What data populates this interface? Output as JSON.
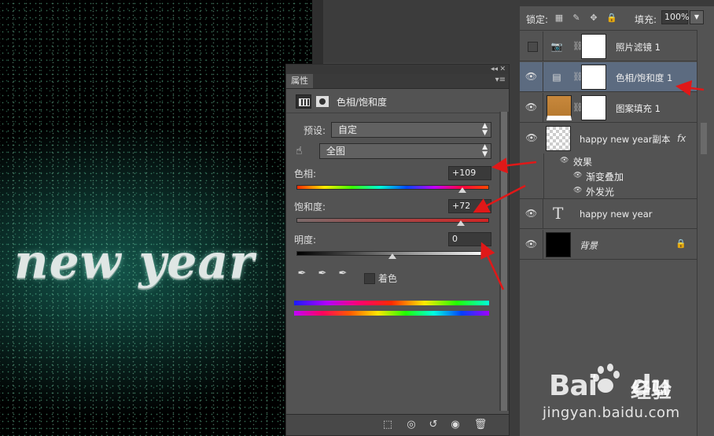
{
  "canvas": {
    "text": "new year"
  },
  "properties": {
    "tab_label": "属性",
    "title": "色相/饱和度",
    "preset_label": "预设:",
    "preset_value": "自定",
    "channel_value": "全图",
    "hue_label": "色相:",
    "hue_value": "+109",
    "hue_position": 0.87,
    "saturation_label": "饱和度:",
    "saturation_value": "+72",
    "saturation_position": 0.86,
    "lightness_label": "明度:",
    "lightness_value": "0",
    "lightness_position": 0.5,
    "colorize_label": "着色",
    "colorize_checked": false
  },
  "layers": {
    "lock_label": "锁定:",
    "fill_label": "填充:",
    "fill_value": "100%",
    "items": [
      {
        "name": "照片滤镜 1",
        "visible": false,
        "type": "adjustment"
      },
      {
        "name": "色相/饱和度 1",
        "visible": true,
        "selected": true,
        "type": "adjustment"
      },
      {
        "name": "图案填充 1",
        "visible": true,
        "type": "fill"
      },
      {
        "name": "happy new year副本",
        "visible": true,
        "type": "text-raster",
        "fx": "fx",
        "effects_label": "效果",
        "effects": [
          "渐变叠加",
          "外发光"
        ]
      },
      {
        "name": "happy new year",
        "visible": true,
        "type": "text",
        "icon": "T"
      },
      {
        "name": "背景",
        "visible": true,
        "type": "background"
      }
    ]
  },
  "watermark": {
    "logo_text": "Bai",
    "logo_suffix": "du",
    "brand_cn": "经验",
    "url": "jingyan.baidu.com"
  },
  "colors": {
    "annotation_arrow": "#e01818",
    "selected_layer": "#5c6b80"
  }
}
